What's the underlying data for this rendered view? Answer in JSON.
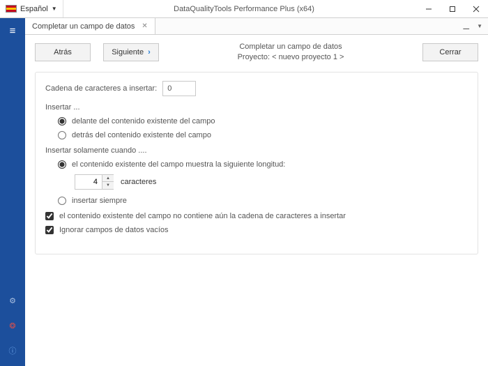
{
  "titlebar": {
    "language": "Español",
    "app_title": "DataQualityTools Performance Plus (x64)"
  },
  "tab": {
    "label": "Completar un campo de datos"
  },
  "toolbar": {
    "back": "Atrás",
    "next": "Siguiente",
    "close": "Cerrar",
    "heading": "Completar un campo de datos",
    "project_line": "Proyecto: < nuevo proyecto 1 >"
  },
  "form": {
    "insert_string_label": "Cadena de caracteres a insertar:",
    "insert_string_value": "0",
    "insert_section": "Insertar ...",
    "opt_before": "delante del contenido existente del campo",
    "opt_after": "detrás del contenido existente del campo",
    "when_section": "Insertar solamente cuando ....",
    "opt_length": "el contenido existente del campo muestra la siguiente longitud:",
    "length_value": "4",
    "length_unit": "caracteres",
    "opt_always": "insertar siempre",
    "chk_not_contains": "el contenido existente del campo no contiene aún la cadena de caracteres a insertar",
    "chk_ignore_empty": "Ignorar campos de datos vacíos"
  }
}
